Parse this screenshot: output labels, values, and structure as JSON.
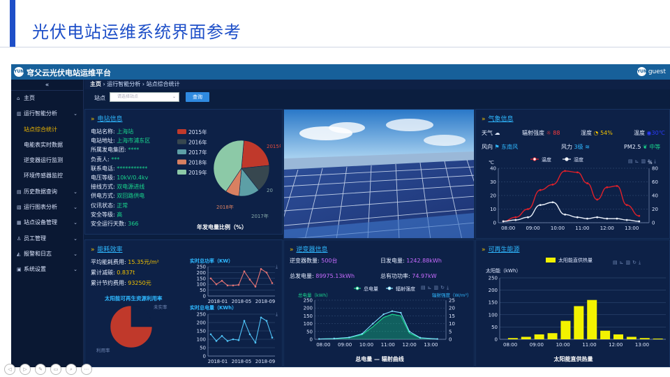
{
  "slide": {
    "title": "光伏电站运维系统界面参考"
  },
  "app": {
    "logo_text": "YUN",
    "title": "穹父云光伏电站运维平台",
    "user": "guest"
  },
  "sidebar": {
    "collapse_icon": "«",
    "items": [
      {
        "label": "主页",
        "icon": "home-icon",
        "glyph": "⌂",
        "chevron": ""
      },
      {
        "label": "运行智能分析",
        "icon": "chart-icon",
        "glyph": "▥",
        "chevron": "⌄"
      },
      {
        "label": "历史数据查询",
        "icon": "folder-icon",
        "glyph": "▤",
        "chevron": "⌄"
      },
      {
        "label": "运行图表分析",
        "icon": "document-icon",
        "glyph": "▧",
        "chevron": "⌄"
      },
      {
        "label": "站点设备管理",
        "icon": "device-icon",
        "glyph": "▦",
        "chevron": "⌄"
      },
      {
        "label": "员工管理",
        "icon": "user-icon",
        "glyph": "♙",
        "chevron": "⌄"
      },
      {
        "label": "报警和日志",
        "icon": "bell-icon",
        "glyph": "◭",
        "chevron": "⌄"
      },
      {
        "label": "系统设置",
        "icon": "settings-icon",
        "glyph": "▣",
        "chevron": "⌄"
      }
    ],
    "subitems": [
      "站点综合统计",
      "电能表实时数据",
      "逆变器运行监测",
      "环境传感器监控"
    ]
  },
  "breadcrumb": {
    "home": "主页",
    "level1": "运行智能分析",
    "level2": "站点综合统计",
    "sep": "›"
  },
  "filter": {
    "label": "站点",
    "placeholder": "请选择站点",
    "button": "查询"
  },
  "station": {
    "title": "电站信息",
    "fields": [
      {
        "k": "电站名称:",
        "v": "上海站"
      },
      {
        "k": "电站地址:",
        "v": "上海市浦东区"
      },
      {
        "k": "所属发电集团:",
        "v": "****"
      },
      {
        "k": "负责人:",
        "v": "***"
      },
      {
        "k": "联系电话:",
        "v": "***********"
      },
      {
        "k": "电压等级:",
        "v": "10kV/0.4kv"
      },
      {
        "k": "接线方式:",
        "v": "双电源进线"
      },
      {
        "k": "供电方式:",
        "v": "双回路供电"
      },
      {
        "k": "仪讯状态:",
        "v": "正常"
      },
      {
        "k": "安全等级:",
        "v": "高"
      },
      {
        "k": "安全运行天数:",
        "v": "366"
      }
    ],
    "pie_caption": "年发电量比例（%）"
  },
  "weather": {
    "title": "气象信息",
    "labels": {
      "weather": "天气",
      "radiation": "辐射强度",
      "humidity": "湿度",
      "temperature": "温度",
      "wind_dir": "风向",
      "wind": "风力",
      "pm": "PM2.5"
    },
    "values": {
      "radiation": "88",
      "humidity": "54%",
      "temperature": "30℃",
      "wind_dir": "东南风",
      "wind": "3级",
      "pm": "中等"
    },
    "icons": {
      "weather": "cloud-icon",
      "radiation": "sun-icon",
      "humidity": "humidity-icon",
      "temperature": "thermometer-icon",
      "wind_dir": "flag-icon",
      "wind": "wind-icon",
      "pm": "leaf-icon"
    },
    "colors": {
      "radiation": "#ff3b3b",
      "humidity": "#f2c200",
      "temperature": "#2a3bff",
      "wind_dir": "#2fb8ff",
      "wind": "#2fb8ff",
      "pm": "#19d68d"
    }
  },
  "efficiency": {
    "title": "能耗效率",
    "fields": [
      {
        "k": "平均能耗费用:",
        "v": "15.35元/m²"
      },
      {
        "k": "累计减碳:",
        "v": "0.837t"
      },
      {
        "k": "累计节约费用:",
        "v": "93250元"
      }
    ],
    "pie_caption": "太阳能可再生资源利用率",
    "pie_labels": {
      "a": "未实率",
      "b": "利用率"
    },
    "chart1_title": "实时总功率（KW）",
    "chart2_title": "实时总电量（KWh）"
  },
  "inverter": {
    "title": "逆变器信息",
    "fields": [
      {
        "k": "逆变器数量:",
        "v": "500台"
      },
      {
        "k": "日发电量:",
        "v": "1242.88kWh"
      },
      {
        "k": "总发电量:",
        "v": "89975.13kWh"
      },
      {
        "k": "总有功功率:",
        "v": "74.97kW"
      }
    ],
    "caption": "总电量 — 辐射曲线"
  },
  "renewable": {
    "title": "可再生能源",
    "caption": "太阳能直供热量"
  },
  "toolbox_glyphs": "▤⊾▥↻⤓",
  "controls": [
    "◁",
    "▷",
    "✎",
    "▭",
    "⌕",
    "⋯"
  ],
  "chart_data": [
    {
      "id": "annual_share",
      "type": "pie",
      "title": "年发电量比例（%）",
      "legend": [
        "2015年",
        "2016年",
        "2017年",
        "2018年",
        "2019年"
      ],
      "labels": [
        "2015年",
        "20",
        "2017年",
        "2018年",
        ""
      ],
      "values": [
        22,
        16,
        12,
        8,
        42
      ],
      "colors": [
        "#c0392b",
        "#37474f",
        "#5d9fa6",
        "#d98061",
        "#8cc9a7"
      ]
    },
    {
      "id": "weather_temp_humidity",
      "type": "line",
      "legend": [
        "温度",
        "湿度"
      ],
      "x": [
        "08:00",
        "09:00",
        "10:00",
        "11:00",
        "12:00",
        "13:00"
      ],
      "xlabel": "",
      "ylabel": "℃",
      "y2label": "%",
      "ylim": [
        0,
        40
      ],
      "y2lim": [
        0,
        80
      ],
      "y_ticks": [
        0,
        10,
        20,
        30,
        40
      ],
      "y2_ticks": [
        0,
        20,
        40,
        60,
        80
      ],
      "series": [
        {
          "name": "温度",
          "color": "#e0202a",
          "xs": [
            7.8,
            8.3,
            8.8,
            9.3,
            9.8,
            10.3,
            10.8,
            11.2,
            11.6,
            12.0,
            12.4,
            12.8,
            13.3
          ],
          "values": [
            1,
            4,
            10,
            24,
            28,
            38,
            37,
            29,
            17,
            26,
            27,
            13,
            5
          ]
        },
        {
          "name": "湿度",
          "color": "#e8eef8",
          "xs": [
            7.8,
            8.3,
            8.8,
            9.3,
            9.8,
            10.3,
            10.8,
            11.2,
            11.6,
            12.0,
            12.4,
            12.8,
            13.3
          ],
          "values": [
            1,
            2,
            4,
            13,
            15,
            6,
            4,
            3,
            4,
            3,
            3,
            2,
            1
          ]
        }
      ]
    },
    {
      "id": "utilization",
      "type": "pie",
      "title": "太阳能可再生资源利用率",
      "labels": [
        "未实率",
        "利用率"
      ],
      "values": [
        25,
        75
      ],
      "colors": [
        "#0d2147",
        "#c0392b"
      ]
    },
    {
      "id": "realtime_power",
      "type": "line",
      "title": "实时总功率（KW）",
      "x": [
        "2018-01",
        "2018-05",
        "2018-09"
      ],
      "ylim": [
        0,
        250
      ],
      "y_ticks": [
        0,
        50,
        100,
        150,
        200,
        250
      ],
      "series": [
        {
          "name": "",
          "color": "#e57373",
          "values": [
            150,
            100,
            130,
            90,
            90,
            95,
            210,
            140,
            80,
            230,
            200,
            110
          ]
        }
      ]
    },
    {
      "id": "realtime_energy",
      "type": "line",
      "title": "实时总电量（KWh）",
      "x": [
        "2018-01",
        "2018-05",
        "2018-09"
      ],
      "ylim": [
        0,
        250
      ],
      "y_ticks": [
        0,
        50,
        100,
        150,
        200,
        250
      ],
      "series": [
        {
          "name": "",
          "color": "#4fc3f7",
          "values": [
            130,
            90,
            120,
            90,
            100,
            95,
            210,
            130,
            80,
            230,
            210,
            110
          ]
        }
      ]
    },
    {
      "id": "energy_radiation",
      "type": "area",
      "title": "总电量 — 辐射曲线",
      "legend": [
        "总电量",
        "辐射强度"
      ],
      "x": [
        "08:00",
        "09:00",
        "10:00",
        "11:00",
        "12:00",
        "13:00"
      ],
      "ylabel": "总电量（kWh）",
      "y2label": "辐射强度（W/m²）",
      "ylim": [
        0,
        250
      ],
      "y2lim": [
        0,
        25
      ],
      "y_ticks": [
        0,
        50,
        100,
        150,
        200,
        250
      ],
      "y2_ticks": [
        0,
        5,
        10,
        15,
        20,
        25
      ],
      "series": [
        {
          "name": "总电量",
          "color": "#19d68d",
          "xs": [
            7.8,
            8.5,
            9.2,
            9.8,
            10.3,
            10.8,
            11.2,
            11.6,
            12.0,
            12.5,
            13.3
          ],
          "values": [
            2,
            4,
            10,
            30,
            80,
            140,
            160,
            150,
            40,
            8,
            2
          ]
        },
        {
          "name": "辐射强度",
          "color": "#7fe0ff",
          "xs": [
            7.8,
            8.5,
            9.2,
            9.8,
            10.3,
            10.8,
            11.2,
            11.6,
            12.0,
            12.5,
            13.3
          ],
          "values": [
            0.2,
            0.5,
            1.2,
            3.5,
            10,
            16,
            18,
            17,
            5,
            1,
            0.2
          ]
        }
      ]
    },
    {
      "id": "solar_heat",
      "type": "bar",
      "title": "太阳能直供热量",
      "legend": [
        "太阳能直供热量"
      ],
      "ylabel": "太阳能（kWh）",
      "x": [
        "08:00",
        "09:00",
        "10:00",
        "11:00",
        "12:00",
        "13:00"
      ],
      "ylim": [
        0,
        250
      ],
      "y_ticks": [
        0,
        50,
        100,
        150,
        200,
        250
      ],
      "series": [
        {
          "name": "太阳能直供热量",
          "color": "#f2f200",
          "xs": [
            8.1,
            8.6,
            9.1,
            9.6,
            10.1,
            10.6,
            11.1,
            11.6,
            12.1,
            12.6,
            13.1,
            13.6
          ],
          "values": [
            5,
            10,
            20,
            25,
            75,
            135,
            160,
            35,
            20,
            10,
            5,
            3
          ]
        }
      ]
    }
  ]
}
